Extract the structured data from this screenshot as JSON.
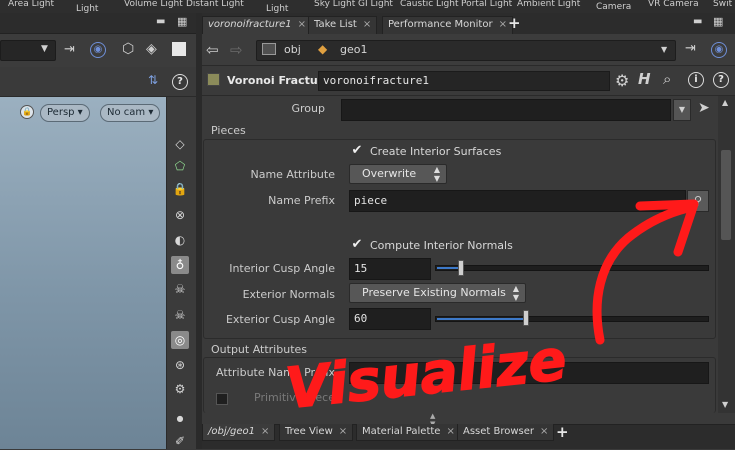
{
  "shelf": {
    "labels": [
      "Area Light",
      "Light",
      "Volume Light",
      "Distant Light",
      "Light",
      "Sky Light",
      "GI Light",
      "Caustic Light",
      "Portal Light",
      "Ambient Light",
      "Camera",
      "VR Camera",
      "Swit"
    ]
  },
  "viewport": {
    "persp_label": "Persp",
    "cam_label": "No cam"
  },
  "tabs": [
    {
      "label": "voronoifracture1",
      "active": true
    },
    {
      "label": "Take List",
      "active": false
    },
    {
      "label": "Performance Monitor",
      "active": false
    }
  ],
  "tab_close": "×",
  "tab_add": "+",
  "path": {
    "obj": "obj",
    "geo": "geo1"
  },
  "node": {
    "type": "Voronoi Fracture",
    "name": "voronoifracture1"
  },
  "params": {
    "group_label": "Group",
    "group_value": "",
    "pieces_section": "Pieces",
    "create_interior_label": "Create Interior Surfaces",
    "create_interior_checked": true,
    "name_attribute_label": "Name Attribute",
    "name_attribute_value": "Overwrite",
    "name_prefix_label": "Name Prefix",
    "name_prefix_value": "piece",
    "compute_normals_label": "Compute Interior Normals",
    "compute_normals_checked": true,
    "interior_cusp_label": "Interior Cusp Angle",
    "interior_cusp_value": "15",
    "interior_cusp_fraction": 0.09,
    "exterior_normals_label": "Exterior Normals",
    "exterior_normals_value": "Preserve Existing Normals",
    "exterior_cusp_label": "Exterior Cusp Angle",
    "exterior_cusp_value": "60",
    "exterior_cusp_fraction": 0.33,
    "output_section": "Output Attributes",
    "attribute_name_prefix_label": "Attribute Name Prefix",
    "primitive_label": "Primitive Piece"
  },
  "bottom_tabs": [
    {
      "label": "/obj/geo1",
      "active": true
    },
    {
      "label": "Tree View",
      "active": false
    },
    {
      "label": "Material Palette",
      "active": false
    },
    {
      "label": "Asset Browser",
      "active": false
    }
  ],
  "annotation": {
    "text": "Visualize",
    "color": "#ff1a1a"
  }
}
